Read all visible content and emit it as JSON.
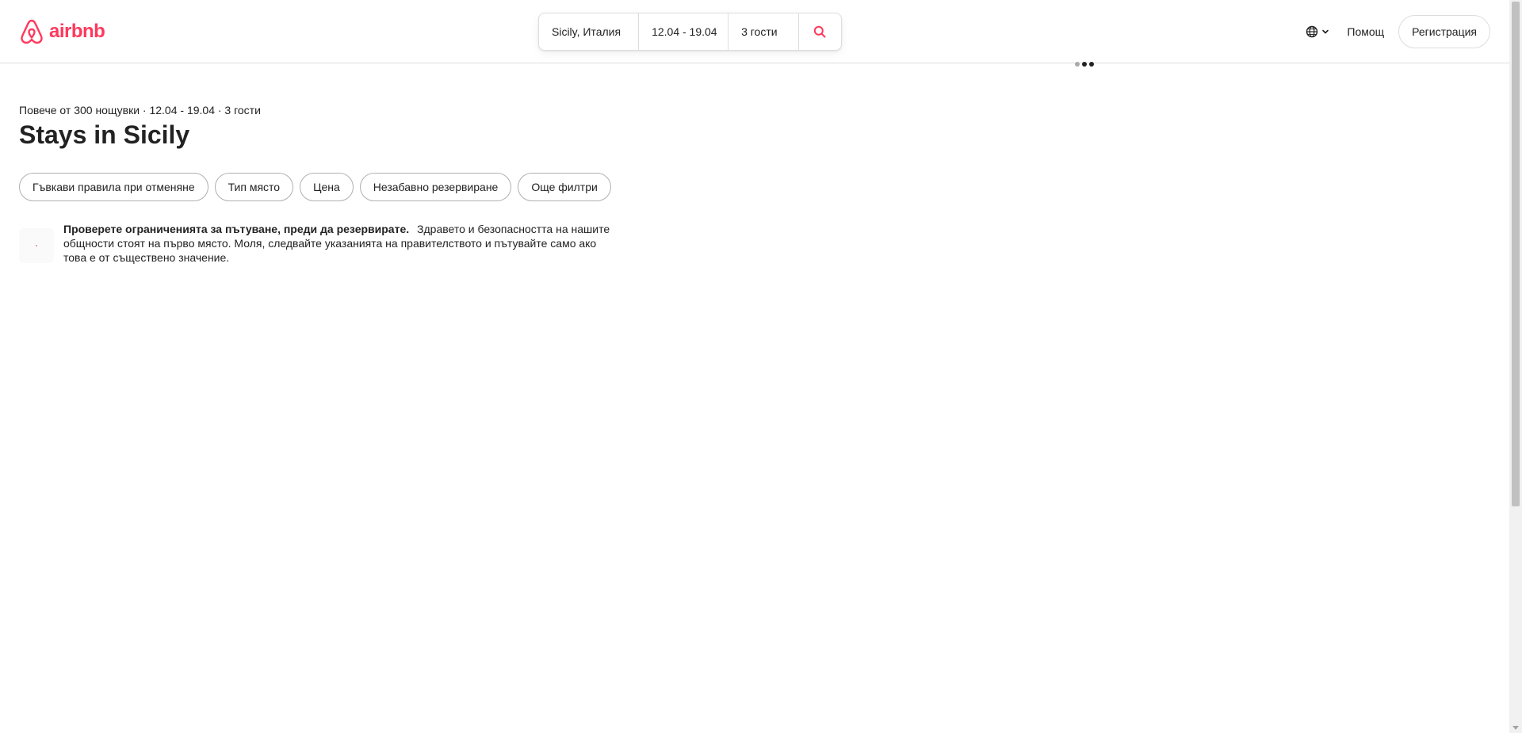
{
  "brand": {
    "name": "airbnb",
    "color": "#FF385C"
  },
  "search": {
    "destination": "Sicily, Италия",
    "dates": "12.04 - 19.04",
    "guests": "3 гости",
    "icon": "search-icon"
  },
  "nav": {
    "language_icon": "globe-icon",
    "help": "Помощ",
    "signup": "Регистрация"
  },
  "results": {
    "summary": "Повече от 300 нощувки · 12.04 - 19.04 · 3 гости",
    "title": "Stays in Sicily"
  },
  "filters": [
    "Гъвкави правила при отменяне",
    "Тип място",
    "Цена",
    "Незабавно резервиране",
    "Още филтри"
  ],
  "notice": {
    "title": "Проверете ограниченията за пътуване, преди да резервирате.",
    "body": "Здравето и безопасността на нашите общности стоят на първо място. Моля, следвайте указанията на правителството и пътувайте само ако това е от съществено значение."
  }
}
